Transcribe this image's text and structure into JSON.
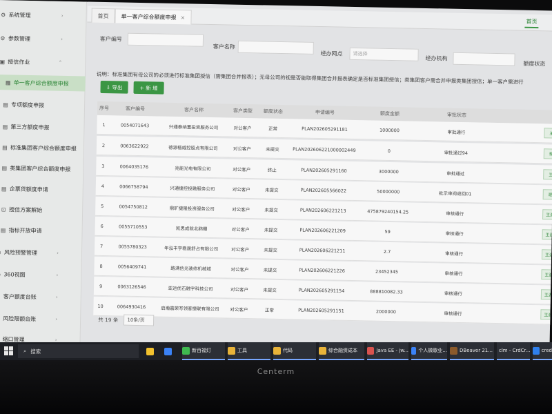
{
  "sidebar": {
    "items": [
      {
        "icon": "gear-icon",
        "glyph": "⚙",
        "label": "系统管理",
        "arrow": "›",
        "sub": false,
        "active": false
      },
      {
        "icon": "gear-icon",
        "glyph": "⚙",
        "label": "参数管理",
        "arrow": "›",
        "sub": false,
        "active": false
      },
      {
        "icon": "credit-icon",
        "glyph": "▣",
        "label": "授信作业",
        "arrow": "⌃",
        "sub": false,
        "active": false
      },
      {
        "icon": "grid-icon",
        "glyph": "▦",
        "label": "单一客户综合额度申报",
        "arrow": "",
        "sub": true,
        "active": true
      },
      {
        "icon": "doc-icon",
        "glyph": "▤",
        "label": "专项额度申报",
        "arrow": "",
        "sub": true,
        "active": false
      },
      {
        "icon": "doc-icon",
        "glyph": "▤",
        "label": "第三方额度申报",
        "arrow": "",
        "sub": true,
        "active": false
      },
      {
        "icon": "doc-icon",
        "glyph": "▤",
        "label": "标准集团客户综合额度申报",
        "arrow": "",
        "sub": true,
        "active": false
      },
      {
        "icon": "doc-icon",
        "glyph": "▤",
        "label": "类集团客户综合额度申报",
        "arrow": "",
        "sub": true,
        "active": false
      },
      {
        "icon": "doc-icon",
        "glyph": "▤",
        "label": "企票贷额度申请",
        "arrow": "",
        "sub": true,
        "active": false
      },
      {
        "icon": "lock-icon",
        "glyph": "⊡",
        "label": "授信方案解始",
        "arrow": "",
        "sub": true,
        "active": false
      },
      {
        "icon": "doc-icon",
        "glyph": "▤",
        "label": "指标开放申请",
        "arrow": "",
        "sub": true,
        "active": false
      },
      {
        "icon": "shield-icon",
        "glyph": "◉",
        "label": "风险预警管理",
        "arrow": "›",
        "sub": false,
        "active": false
      },
      {
        "icon": "view-icon",
        "glyph": "◎",
        "label": "360视图",
        "arrow": "›",
        "sub": false,
        "active": false
      },
      {
        "icon": "ledger-icon",
        "glyph": "▣",
        "label": "客户额度台账",
        "arrow": "›",
        "sub": false,
        "active": false
      },
      {
        "icon": "ledger-icon",
        "glyph": "▣",
        "label": "风险限额台账",
        "arrow": "›",
        "sub": false,
        "active": false
      },
      {
        "icon": "folder-icon",
        "glyph": "▣",
        "label": "缩口管理",
        "arrow": "›",
        "sub": false,
        "active": false
      }
    ]
  },
  "tabs": {
    "home": "首页",
    "current": "单一客户综合额度申报",
    "close": "×",
    "right": "首页"
  },
  "filters": {
    "customer_no": "客户编号",
    "customer_name": "客户名称",
    "branch": "经办网点",
    "branch_placeholder": "请选择",
    "bank": "经办机构",
    "status": "额度状态"
  },
  "description": "说明：标准集团有母公司的必须进行标准集团授信（需集团合并报表）；无母公司的视是否能取得集团合并报表确定是否标准集团授信；类集团客户需合并申报类集团授信；单一客户需进行",
  "buttons": {
    "export": "⇩ 导出",
    "add": "+ 新 增"
  },
  "table": {
    "headers": [
      "序号",
      "客户编号",
      "客户名称",
      "客户类型",
      "额度状态",
      "申请编号",
      "额度金额",
      "审批状态"
    ],
    "rows": [
      [
        "1",
        "0054071643",
        "兴通泰纳置投资服务公司",
        "对公客户",
        "正常",
        "PLAN202605291181",
        "1000000",
        "审批通行",
        "王"
      ],
      [
        "2",
        "0063622922",
        "德源楷威控股点有限公司",
        "对公客户",
        "未提交",
        "PLAN202606221000002449",
        "0",
        "审批通过94",
        "现"
      ],
      [
        "3",
        "0064035176",
        "兆能光电有限公司",
        "对公客户",
        "终止",
        "PLAN202605291160",
        "3000000",
        "审批通过",
        "王"
      ],
      [
        "4",
        "0066758794",
        "兴通捷控投融服务公司",
        "对公客户",
        "未提交",
        "PLAN202605566022",
        "50000000",
        "批示审阅退回01",
        "现"
      ],
      [
        "5",
        "0054750812",
        "鼎旷捷隆投资服务公司",
        "对公客户",
        "未提交",
        "PLAN202606221213",
        "475879240154.25",
        "审核通行",
        "王源"
      ],
      [
        "6",
        "0055710553",
        "凯思成就北鸥棚",
        "对公客户",
        "未提交",
        "PLAN202606221209",
        "59",
        "审核通行",
        "王源"
      ],
      [
        "7",
        "0055780323",
        "年泓丰宇稳晟舒占有限公司",
        "对公客户",
        "未提交",
        "PLAN202606221211",
        "2.7",
        "审核通行",
        "王源"
      ],
      [
        "8",
        "0056409741",
        "路满信光装修机械城",
        "对公客户",
        "未提交",
        "PLAN202606221226",
        "23452345",
        "审核通行",
        "王源"
      ],
      [
        "9",
        "0063126546",
        "亚运优石融宇科技公司",
        "对公客户",
        "未提交",
        "PLAN202605291154",
        "888810082.33",
        "审核通行",
        "王源"
      ],
      [
        "10",
        "0064930416",
        "启瀚嘉荣写领客捷联有限公司",
        "对公客户",
        "正常",
        "PLAN202605291151",
        "2000000",
        "审核通行",
        "王源"
      ]
    ]
  },
  "pager": {
    "total": "共 19 条",
    "page_size": "10条/页"
  },
  "taskbar": {
    "search": "搜索",
    "items": [
      {
        "icon": "chrome-icon",
        "label": "",
        "color": "#f2c12e"
      },
      {
        "icon": "settings-icon",
        "label": "",
        "color": "#3b82f6"
      },
      {
        "icon": "wechat-work-icon",
        "label": "新百福灯",
        "color": "#3fb950"
      },
      {
        "icon": "folder-icon",
        "label": "工具",
        "color": "#e8b339"
      },
      {
        "icon": "folder-icon",
        "label": "代码",
        "color": "#e8b339"
      },
      {
        "icon": "folder-icon",
        "label": "综合融资成本",
        "color": "#e8b339"
      },
      {
        "icon": "java-icon",
        "label": "Java EE - jw...",
        "color": "#d9534f"
      },
      {
        "icon": "app-icon",
        "label": "个人微歌业...",
        "color": "#3b82f6"
      },
      {
        "icon": "dbeaver-icon",
        "label": "DBeaver 21...",
        "color": "#8b5a2b"
      },
      {
        "icon": "terminal-icon",
        "label": "clm - CrdCr...",
        "color": "#9aa0a6"
      },
      {
        "icon": "vscode-icon",
        "label": "cred",
        "color": "#2f80ed"
      }
    ]
  },
  "monitor": {
    "brand": "Centerm"
  }
}
